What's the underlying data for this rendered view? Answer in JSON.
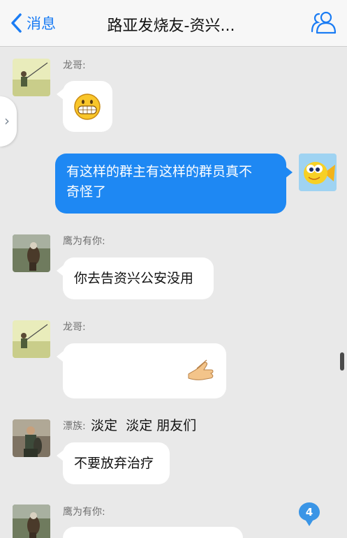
{
  "nav": {
    "back_label": "消息",
    "title": "路亚发烧友-资兴..."
  },
  "messages": [
    {
      "sender": "龙哥:",
      "content": "grinning-face-emoji"
    },
    {
      "sender": "",
      "text": "有这样的群主有这样的群员真不奇怪了",
      "line1": "有这样的群主有这样的群员真不",
      "line2": "奇怪了"
    },
    {
      "sender": "鹰为有你:",
      "text": "你去告资兴公安没用"
    },
    {
      "sender": "龙哥:",
      "text": "淡定  淡定 朋友们",
      "emoji": "handshake-gesture-emoji"
    },
    {
      "sender": "漂族:",
      "text": "不要放弃治疗"
    },
    {
      "sender": "鹰为有你:",
      "text": ""
    }
  ],
  "unread_badge": "4",
  "colors": {
    "accent": "#1a7cf4",
    "outgoing_bubble": "#1e88f3",
    "background": "#e9e9e9"
  }
}
